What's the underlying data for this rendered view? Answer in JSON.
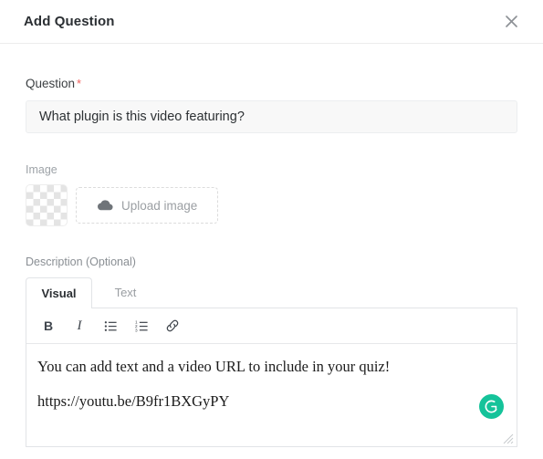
{
  "header": {
    "title": "Add Question",
    "close_icon": "close-icon"
  },
  "question_field": {
    "label": "Question",
    "required_marker": "*",
    "value": "What plugin is this video featuring?",
    "placeholder": "Question"
  },
  "image_section": {
    "label": "Image",
    "thumbnail_icon": "transparent-checkerboard-placeholder",
    "upload_button": {
      "label": "Upload image",
      "icon": "cloud-upload-icon"
    }
  },
  "description_section": {
    "label": "Description (Optional)",
    "tabs": [
      {
        "label": "Visual",
        "active": true
      },
      {
        "label": "Text",
        "active": false
      }
    ],
    "toolbar": [
      {
        "name": "bold-icon",
        "glyph": "B"
      },
      {
        "name": "italic-icon",
        "glyph": "I"
      },
      {
        "name": "unordered-list-icon",
        "glyph": ""
      },
      {
        "name": "ordered-list-icon",
        "glyph": ""
      },
      {
        "name": "link-icon",
        "glyph": ""
      }
    ],
    "content": {
      "paragraph_1": "You can add text and a video URL to include in your quiz!",
      "paragraph_2": "https://youtu.be/B9fr1BXGyPY"
    },
    "grammarly": {
      "name": "grammarly-icon",
      "letter": "G",
      "color": "#15c39a"
    },
    "resize_handle": "resize-grip-icon"
  },
  "colors": {
    "required_asterisk": "#f0625f",
    "input_background": "#f8f8f8",
    "border": "#e2e4e7",
    "grammarly_green": "#15c39a"
  }
}
